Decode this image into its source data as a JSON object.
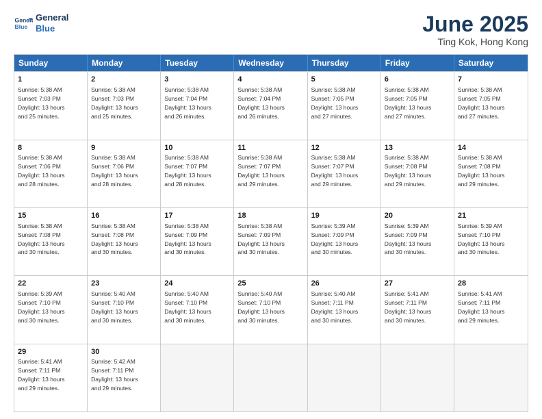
{
  "header": {
    "logo_line1": "General",
    "logo_line2": "Blue",
    "main_title": "June 2025",
    "subtitle": "Ting Kok, Hong Kong"
  },
  "calendar": {
    "weekdays": [
      "Sunday",
      "Monday",
      "Tuesday",
      "Wednesday",
      "Thursday",
      "Friday",
      "Saturday"
    ],
    "weeks": [
      [
        {
          "num": "",
          "empty": true
        },
        {
          "num": "",
          "empty": true
        },
        {
          "num": "",
          "empty": true
        },
        {
          "num": "",
          "empty": true
        },
        {
          "num": "",
          "empty": true
        },
        {
          "num": "",
          "empty": true
        },
        {
          "num": "",
          "empty": true
        }
      ],
      [
        {
          "num": "1",
          "rise": "5:38 AM",
          "set": "7:03 PM",
          "hours": "13",
          "mins": "25"
        },
        {
          "num": "2",
          "rise": "5:38 AM",
          "set": "7:03 PM",
          "hours": "13",
          "mins": "25"
        },
        {
          "num": "3",
          "rise": "5:38 AM",
          "set": "7:04 PM",
          "hours": "13",
          "mins": "26"
        },
        {
          "num": "4",
          "rise": "5:38 AM",
          "set": "7:04 PM",
          "hours": "13",
          "mins": "26"
        },
        {
          "num": "5",
          "rise": "5:38 AM",
          "set": "7:05 PM",
          "hours": "13",
          "mins": "27"
        },
        {
          "num": "6",
          "rise": "5:38 AM",
          "set": "7:05 PM",
          "hours": "13",
          "mins": "27"
        },
        {
          "num": "7",
          "rise": "5:38 AM",
          "set": "7:05 PM",
          "hours": "13",
          "mins": "27"
        }
      ],
      [
        {
          "num": "8",
          "rise": "5:38 AM",
          "set": "7:06 PM",
          "hours": "13",
          "mins": "28"
        },
        {
          "num": "9",
          "rise": "5:38 AM",
          "set": "7:06 PM",
          "hours": "13",
          "mins": "28"
        },
        {
          "num": "10",
          "rise": "5:38 AM",
          "set": "7:07 PM",
          "hours": "13",
          "mins": "28"
        },
        {
          "num": "11",
          "rise": "5:38 AM",
          "set": "7:07 PM",
          "hours": "13",
          "mins": "29"
        },
        {
          "num": "12",
          "rise": "5:38 AM",
          "set": "7:07 PM",
          "hours": "13",
          "mins": "29"
        },
        {
          "num": "13",
          "rise": "5:38 AM",
          "set": "7:08 PM",
          "hours": "13",
          "mins": "29"
        },
        {
          "num": "14",
          "rise": "5:38 AM",
          "set": "7:08 PM",
          "hours": "13",
          "mins": "29"
        }
      ],
      [
        {
          "num": "15",
          "rise": "5:38 AM",
          "set": "7:08 PM",
          "hours": "13",
          "mins": "30"
        },
        {
          "num": "16",
          "rise": "5:38 AM",
          "set": "7:08 PM",
          "hours": "13",
          "mins": "30"
        },
        {
          "num": "17",
          "rise": "5:38 AM",
          "set": "7:09 PM",
          "hours": "13",
          "mins": "30"
        },
        {
          "num": "18",
          "rise": "5:38 AM",
          "set": "7:09 PM",
          "hours": "13",
          "mins": "30"
        },
        {
          "num": "19",
          "rise": "5:39 AM",
          "set": "7:09 PM",
          "hours": "13",
          "mins": "30"
        },
        {
          "num": "20",
          "rise": "5:39 AM",
          "set": "7:09 PM",
          "hours": "13",
          "mins": "30"
        },
        {
          "num": "21",
          "rise": "5:39 AM",
          "set": "7:10 PM",
          "hours": "13",
          "mins": "30"
        }
      ],
      [
        {
          "num": "22",
          "rise": "5:39 AM",
          "set": "7:10 PM",
          "hours": "13",
          "mins": "30"
        },
        {
          "num": "23",
          "rise": "5:40 AM",
          "set": "7:10 PM",
          "hours": "13",
          "mins": "30"
        },
        {
          "num": "24",
          "rise": "5:40 AM",
          "set": "7:10 PM",
          "hours": "13",
          "mins": "30"
        },
        {
          "num": "25",
          "rise": "5:40 AM",
          "set": "7:10 PM",
          "hours": "13",
          "mins": "30"
        },
        {
          "num": "26",
          "rise": "5:40 AM",
          "set": "7:11 PM",
          "hours": "13",
          "mins": "30"
        },
        {
          "num": "27",
          "rise": "5:41 AM",
          "set": "7:11 PM",
          "hours": "13",
          "mins": "30"
        },
        {
          "num": "28",
          "rise": "5:41 AM",
          "set": "7:11 PM",
          "hours": "13",
          "mins": "29"
        }
      ],
      [
        {
          "num": "29",
          "rise": "5:41 AM",
          "set": "7:11 PM",
          "hours": "13",
          "mins": "29"
        },
        {
          "num": "30",
          "rise": "5:42 AM",
          "set": "7:11 PM",
          "hours": "13",
          "mins": "29"
        },
        {
          "num": "",
          "empty": true
        },
        {
          "num": "",
          "empty": true
        },
        {
          "num": "",
          "empty": true
        },
        {
          "num": "",
          "empty": true
        },
        {
          "num": "",
          "empty": true
        }
      ]
    ]
  }
}
